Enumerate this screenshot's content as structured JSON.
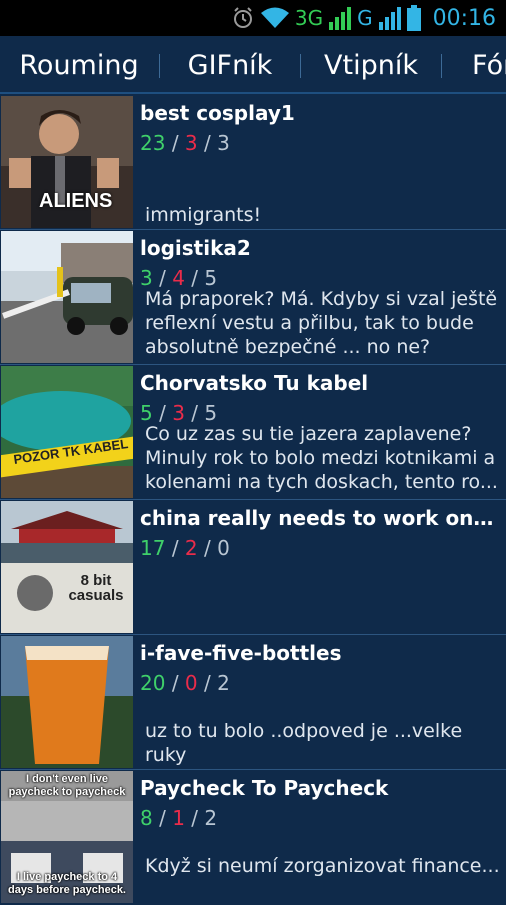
{
  "status_bar": {
    "network_1": "3G",
    "network_2": "G",
    "time": "00:16",
    "icons": [
      "alarm-icon",
      "wifi-icon",
      "signal-icon",
      "signal-icon",
      "battery-icon"
    ]
  },
  "tabs": [
    {
      "label": "Rouming",
      "active": true
    },
    {
      "label": "GIFník",
      "active": false
    },
    {
      "label": "Vtipník",
      "active": false
    },
    {
      "label": "Fór",
      "active": false
    }
  ],
  "items": [
    {
      "title": "best cosplay1",
      "up": "23",
      "down": "3",
      "comments": "3",
      "description": "immigrants!",
      "thumb_caption": "ALIENS"
    },
    {
      "title": "logistika2",
      "up": "3",
      "down": "4",
      "comments": "5",
      "description": "Má praporek? Má. Kdyby si vzal ještě reflexní vestu a přilbu, tak to bude absolutně bezpečné ... no ne?"
    },
    {
      "title": "Chorvatsko Tu kabel",
      "up": "5",
      "down": "3",
      "comments": "5",
      "description": "Co uz zas su tie jazera zaplavene? Minuly rok to bolo medzi kotnikami a kolenami na tych doskach, tento ro...",
      "thumb_caption": "POZOR TK KABEL"
    },
    {
      "title": "china really needs to work on their…",
      "up": "17",
      "down": "2",
      "comments": "0",
      "description": "",
      "thumb_caption": "8 bit casuals"
    },
    {
      "title": "i-fave-five-bottles",
      "up": "20",
      "down": "0",
      "comments": "2",
      "description": "uz to tu bolo ..odpoved je ...velke ruky"
    },
    {
      "title": "Paycheck To Paycheck",
      "up": "8",
      "down": "1",
      "comments": "2",
      "description": "Když si neumí zorganizovat finance...",
      "thumb_caption_top": "I don't even live paycheck to paycheck",
      "thumb_caption_bottom": "I live paycheck to 4 days before paycheck."
    }
  ],
  "colors": {
    "background": "#0f2a4a",
    "accent": "#33b5e5",
    "upvote": "#3fd06a",
    "downvote": "#ea2c4a"
  }
}
